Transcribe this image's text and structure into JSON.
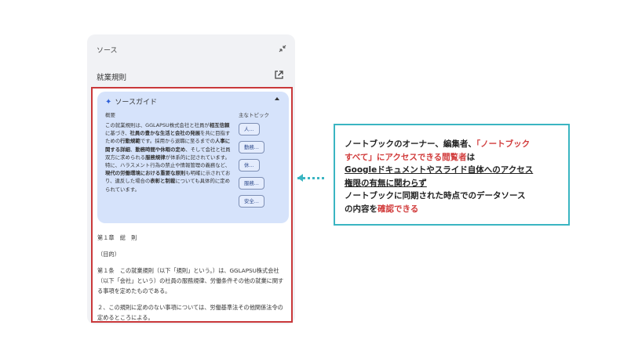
{
  "panel": {
    "title": "ソース",
    "doc_title": "就業規則"
  },
  "guide": {
    "title": "ソースガイド",
    "summary_label": "概要",
    "topics_label": "主なトピック",
    "summary": [
      {
        "t": "この就業規則は、GGLAPSU株式会社と社員が",
        "b": false
      },
      {
        "t": "相互信頼",
        "b": true
      },
      {
        "t": "に基づき、",
        "b": false
      },
      {
        "t": "社員の豊かな生活と会社",
        "b": true
      },
      {
        "t": "の発展",
        "b": true
      },
      {
        "t": "を共に目指すための",
        "b": false
      },
      {
        "t": "行動規範",
        "b": true
      },
      {
        "t": "です。採",
        "b": false
      },
      {
        "t": "用から退職に至るまでの",
        "b": false
      },
      {
        "t": "人事に関する詳細",
        "b": true
      },
      {
        "t": "、",
        "b": false
      },
      {
        "t": "勤務時間や休暇の定め",
        "b": true
      },
      {
        "t": "、そして会社と社員双",
        "b": false
      },
      {
        "t": "方に求められる",
        "b": false
      },
      {
        "t": "服務規律",
        "b": true
      },
      {
        "t": "が体系的に記されて",
        "b": false
      },
      {
        "t": "います。特に、ハラスメント行為の禁止や情",
        "b": false
      },
      {
        "t": "報管理の義務など、",
        "b": false
      },
      {
        "t": "現代の労働環境における",
        "b": true
      },
      {
        "t": "重要な原則",
        "b": true
      },
      {
        "t": "も明確に示されており、違反した",
        "b": false
      },
      {
        "t": "場合の",
        "b": false
      },
      {
        "t": "表彰と制裁",
        "b": true
      },
      {
        "t": "についても具体的に定めら",
        "b": false
      },
      {
        "t": "れています。",
        "b": false
      }
    ],
    "topics": [
      "人...",
      "勤務...",
      "休...",
      "服務...",
      "安全..."
    ]
  },
  "body": {
    "chapter": "第１章　総　則",
    "section": "（目的）",
    "article1": "第１条　この就業規則（以下「規則」という。）は、GGLAPSU株式会社（以下「会社」という）の社員の服務規律、労働条件その他の就業に関する事項を定めたものである。",
    "article2": "２、この規則に定めのない事項については、労働基準法その他関係法令の定めるところによる。"
  },
  "callout": {
    "l1a": "ノートブックのオーナー、編集者、",
    "l1b": "「ノートブック",
    "l2a": "すべて」にアクセスできる閲覧者",
    "l2b": "は",
    "l3": "Googleドキュメントやスライド自体へのアクセス",
    "l4": "権限の有無に関わらず",
    "l5": "ノートブックに同期された時点でのデータソース",
    "l6a": "の内容を",
    "l6b": "確認できる"
  },
  "colors": {
    "accent_red": "#c9383a",
    "accent_teal": "#3ab5c2",
    "guide_bg": "#d6e3fb"
  }
}
